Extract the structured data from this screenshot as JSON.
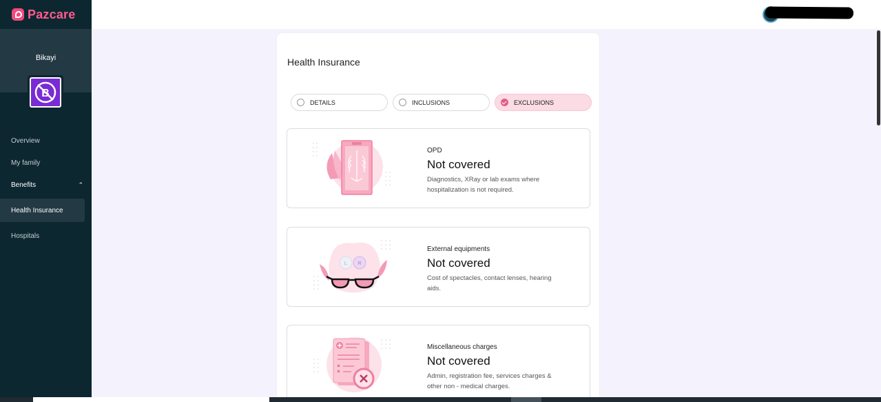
{
  "app": {
    "logo_text": "Pazcare",
    "brand_color": "#ff5b8d"
  },
  "company": {
    "name": "Bikayi",
    "logo_color": "#7a2bd4"
  },
  "sidebar": {
    "items": [
      {
        "label": "Overview"
      },
      {
        "label": "My family"
      },
      {
        "label": "Benefits"
      },
      {
        "label": "Health Insurance"
      },
      {
        "label": "Hospitals"
      }
    ],
    "active_item": "Health Insurance"
  },
  "main": {
    "title": "Health Insurance",
    "tabs": [
      {
        "label": "DETAILS",
        "selected": false
      },
      {
        "label": "INCLUSIONS",
        "selected": false
      },
      {
        "label": "EXCLUSIONS",
        "selected": true
      }
    ],
    "exclusions": [
      {
        "category": "OPD",
        "status": "Not covered",
        "description": "Diagnostics, XRay or lab exams where hospitalization is not required.",
        "icon": "xray-icon"
      },
      {
        "category": "External equipments",
        "status": "Not covered",
        "description": "Cost of spectacles, contact lenses, hearing aids.",
        "icon": "spectacles-icon"
      },
      {
        "category": "Miscellaneous charges",
        "status": "Not covered",
        "description": "Admin, registration fee, services charges & other non - medical charges.",
        "icon": "document-cross-icon"
      }
    ]
  },
  "colors": {
    "accent_pink": "#e55c84",
    "selected_tab_bg": "#fbdbe4",
    "sidebar_bg": "#0d2731"
  }
}
